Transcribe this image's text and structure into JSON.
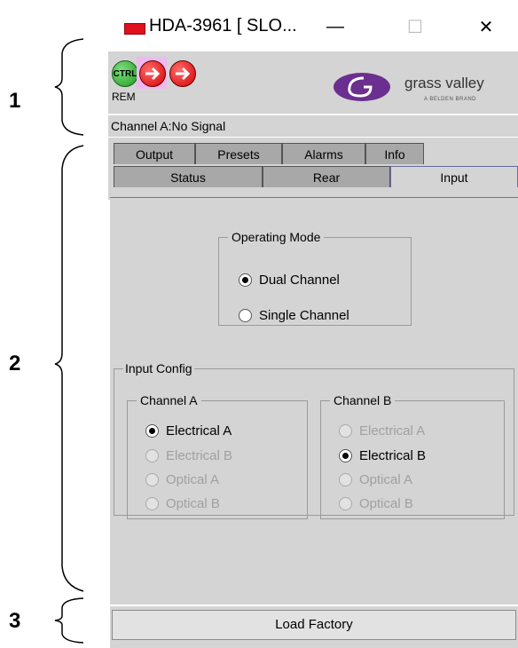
{
  "callouts": [
    "1",
    "2",
    "3"
  ],
  "window": {
    "title": "HDA-3961 [ SLO...",
    "minimize_glyph": "—",
    "maximize_glyph": "☐",
    "close_glyph": "✕"
  },
  "header": {
    "ctrl_label": "CTRL",
    "rem_label": "REM",
    "logo_name": "grass valley",
    "logo_tagline": "A BELDEN BRAND",
    "colors": {
      "ctrl": "#2ea52e",
      "arrow": "#e00000",
      "arrow_bg": "#f0b8f0"
    }
  },
  "status_line": "Channel A:No Signal",
  "tabs": {
    "row1": [
      "Output",
      "Presets",
      "Alarms",
      "Info"
    ],
    "row2": [
      "Status",
      "Rear",
      "Input"
    ],
    "active": "Input"
  },
  "operating_mode": {
    "legend": "Operating Mode",
    "options": [
      {
        "label": "Dual Channel",
        "checked": true
      },
      {
        "label": "Single Channel",
        "checked": false
      }
    ]
  },
  "input_config": {
    "legend": "Input Config",
    "channel_a": {
      "legend": "Channel A",
      "options": [
        {
          "label": "Electrical A",
          "checked": true,
          "disabled": false
        },
        {
          "label": "Electrical B",
          "checked": false,
          "disabled": true
        },
        {
          "label": "Optical A",
          "checked": false,
          "disabled": true
        },
        {
          "label": "Optical B",
          "checked": false,
          "disabled": true
        }
      ]
    },
    "channel_b": {
      "legend": "Channel B",
      "options": [
        {
          "label": "Electrical A",
          "checked": false,
          "disabled": true
        },
        {
          "label": "Electrical B",
          "checked": true,
          "disabled": false
        },
        {
          "label": "Optical A",
          "checked": false,
          "disabled": true
        },
        {
          "label": "Optical B",
          "checked": false,
          "disabled": true
        }
      ]
    }
  },
  "footer": {
    "load_factory_label": "Load Factory"
  }
}
